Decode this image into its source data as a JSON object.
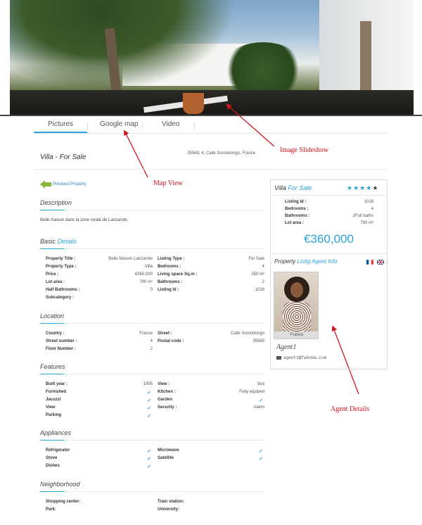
{
  "tabs": [
    "Pictures",
    "Google map",
    "Video"
  ],
  "annotations": {
    "slideshow": "Image Slideshow",
    "map_view": "Map View",
    "agent_details": "Agent Details"
  },
  "property": {
    "title": "Villa - For Sale",
    "address": "35560, 4, Calle Sorondongo, France",
    "previous": "Previous Property"
  },
  "description": {
    "heading": "Description",
    "text": "Belle maison dans la zone rurale de Lanzarote."
  },
  "basic": {
    "heading_a": "Basic",
    "heading_b": "Details",
    "left": [
      {
        "k": "Property Title :",
        "v": "Belle Maison Lanzarote"
      },
      {
        "k": "Property Type :",
        "v": "Villa"
      },
      {
        "k": "Price :",
        "v": "€360,000"
      },
      {
        "k": "Lot area :",
        "v": "780 m²"
      },
      {
        "k": "Half Bathrooms :",
        "v": "0"
      },
      {
        "k": "Subcategory :",
        "v": ""
      }
    ],
    "right": [
      {
        "k": "Listing Type :",
        "v": "For Sale"
      },
      {
        "k": "Bedrooms :",
        "v": "4"
      },
      {
        "k": "Living space Sq.m :",
        "v": "250 m²"
      },
      {
        "k": "Bathrooms :",
        "v": "2"
      },
      {
        "k": "Listing Id :",
        "v": "1018"
      }
    ]
  },
  "location": {
    "heading": "Location",
    "left": [
      {
        "k": "Country :",
        "v": "France"
      },
      {
        "k": "Street number :",
        "v": "4"
      },
      {
        "k": "Floor Number :",
        "v": "2"
      }
    ],
    "right": [
      {
        "k": "Street :",
        "v": "Calle Sorondongo"
      },
      {
        "k": "Postal code :",
        "v": "35560"
      }
    ]
  },
  "features": {
    "heading": "Features",
    "left": [
      {
        "k": "Built year :",
        "v": "1995"
      },
      {
        "k": "Furnished",
        "v": "✓"
      },
      {
        "k": "Jacuzzi",
        "v": "✓"
      },
      {
        "k": "View",
        "v": "✓"
      },
      {
        "k": "Parking",
        "v": "✓"
      }
    ],
    "right": [
      {
        "k": "View :",
        "v": "Sea"
      },
      {
        "k": "Kitchen :",
        "v": "Fully equiped"
      },
      {
        "k": "Garden",
        "v": "✓"
      },
      {
        "k": "Security :",
        "v": "Alarm"
      }
    ]
  },
  "appliances": {
    "heading": "Appliances",
    "left": [
      {
        "k": "Refrigerator",
        "v": "✓"
      },
      {
        "k": "Stove",
        "v": "✓"
      },
      {
        "k": "Dishes",
        "v": "✓"
      }
    ],
    "right": [
      {
        "k": "Microwave",
        "v": "✓"
      },
      {
        "k": "Satellite",
        "v": "✓"
      }
    ]
  },
  "neighborhood": {
    "heading": "Neighborhood",
    "left": [
      {
        "k": "Shopping center:",
        "v": ""
      },
      {
        "k": "Park:",
        "v": ""
      }
    ],
    "right": [
      {
        "k": "Train station:",
        "v": ""
      },
      {
        "k": "University:",
        "v": ""
      }
    ]
  },
  "sidebar": {
    "title_a": "Villa",
    "title_b": "For Sale",
    "stars_on": 4,
    "stars_total": 5,
    "rows": [
      {
        "k": "Listing Id :",
        "v": "1018"
      },
      {
        "k": "Bedrooms :",
        "v": "4"
      },
      {
        "k": "Bathrooms :",
        "v": "2Full baths"
      },
      {
        "k": "Lot area :",
        "v": "780 m²"
      }
    ],
    "price": "€360,000",
    "agent_heading_a": "Property",
    "agent_heading_b": "Listig Agent Info",
    "agent_location": "France",
    "agent_name": "Agent1",
    "agent_email": "agent1@faboba.com"
  },
  "colors": {
    "accent": "#29a3d8",
    "annotation": "#d4161c"
  }
}
